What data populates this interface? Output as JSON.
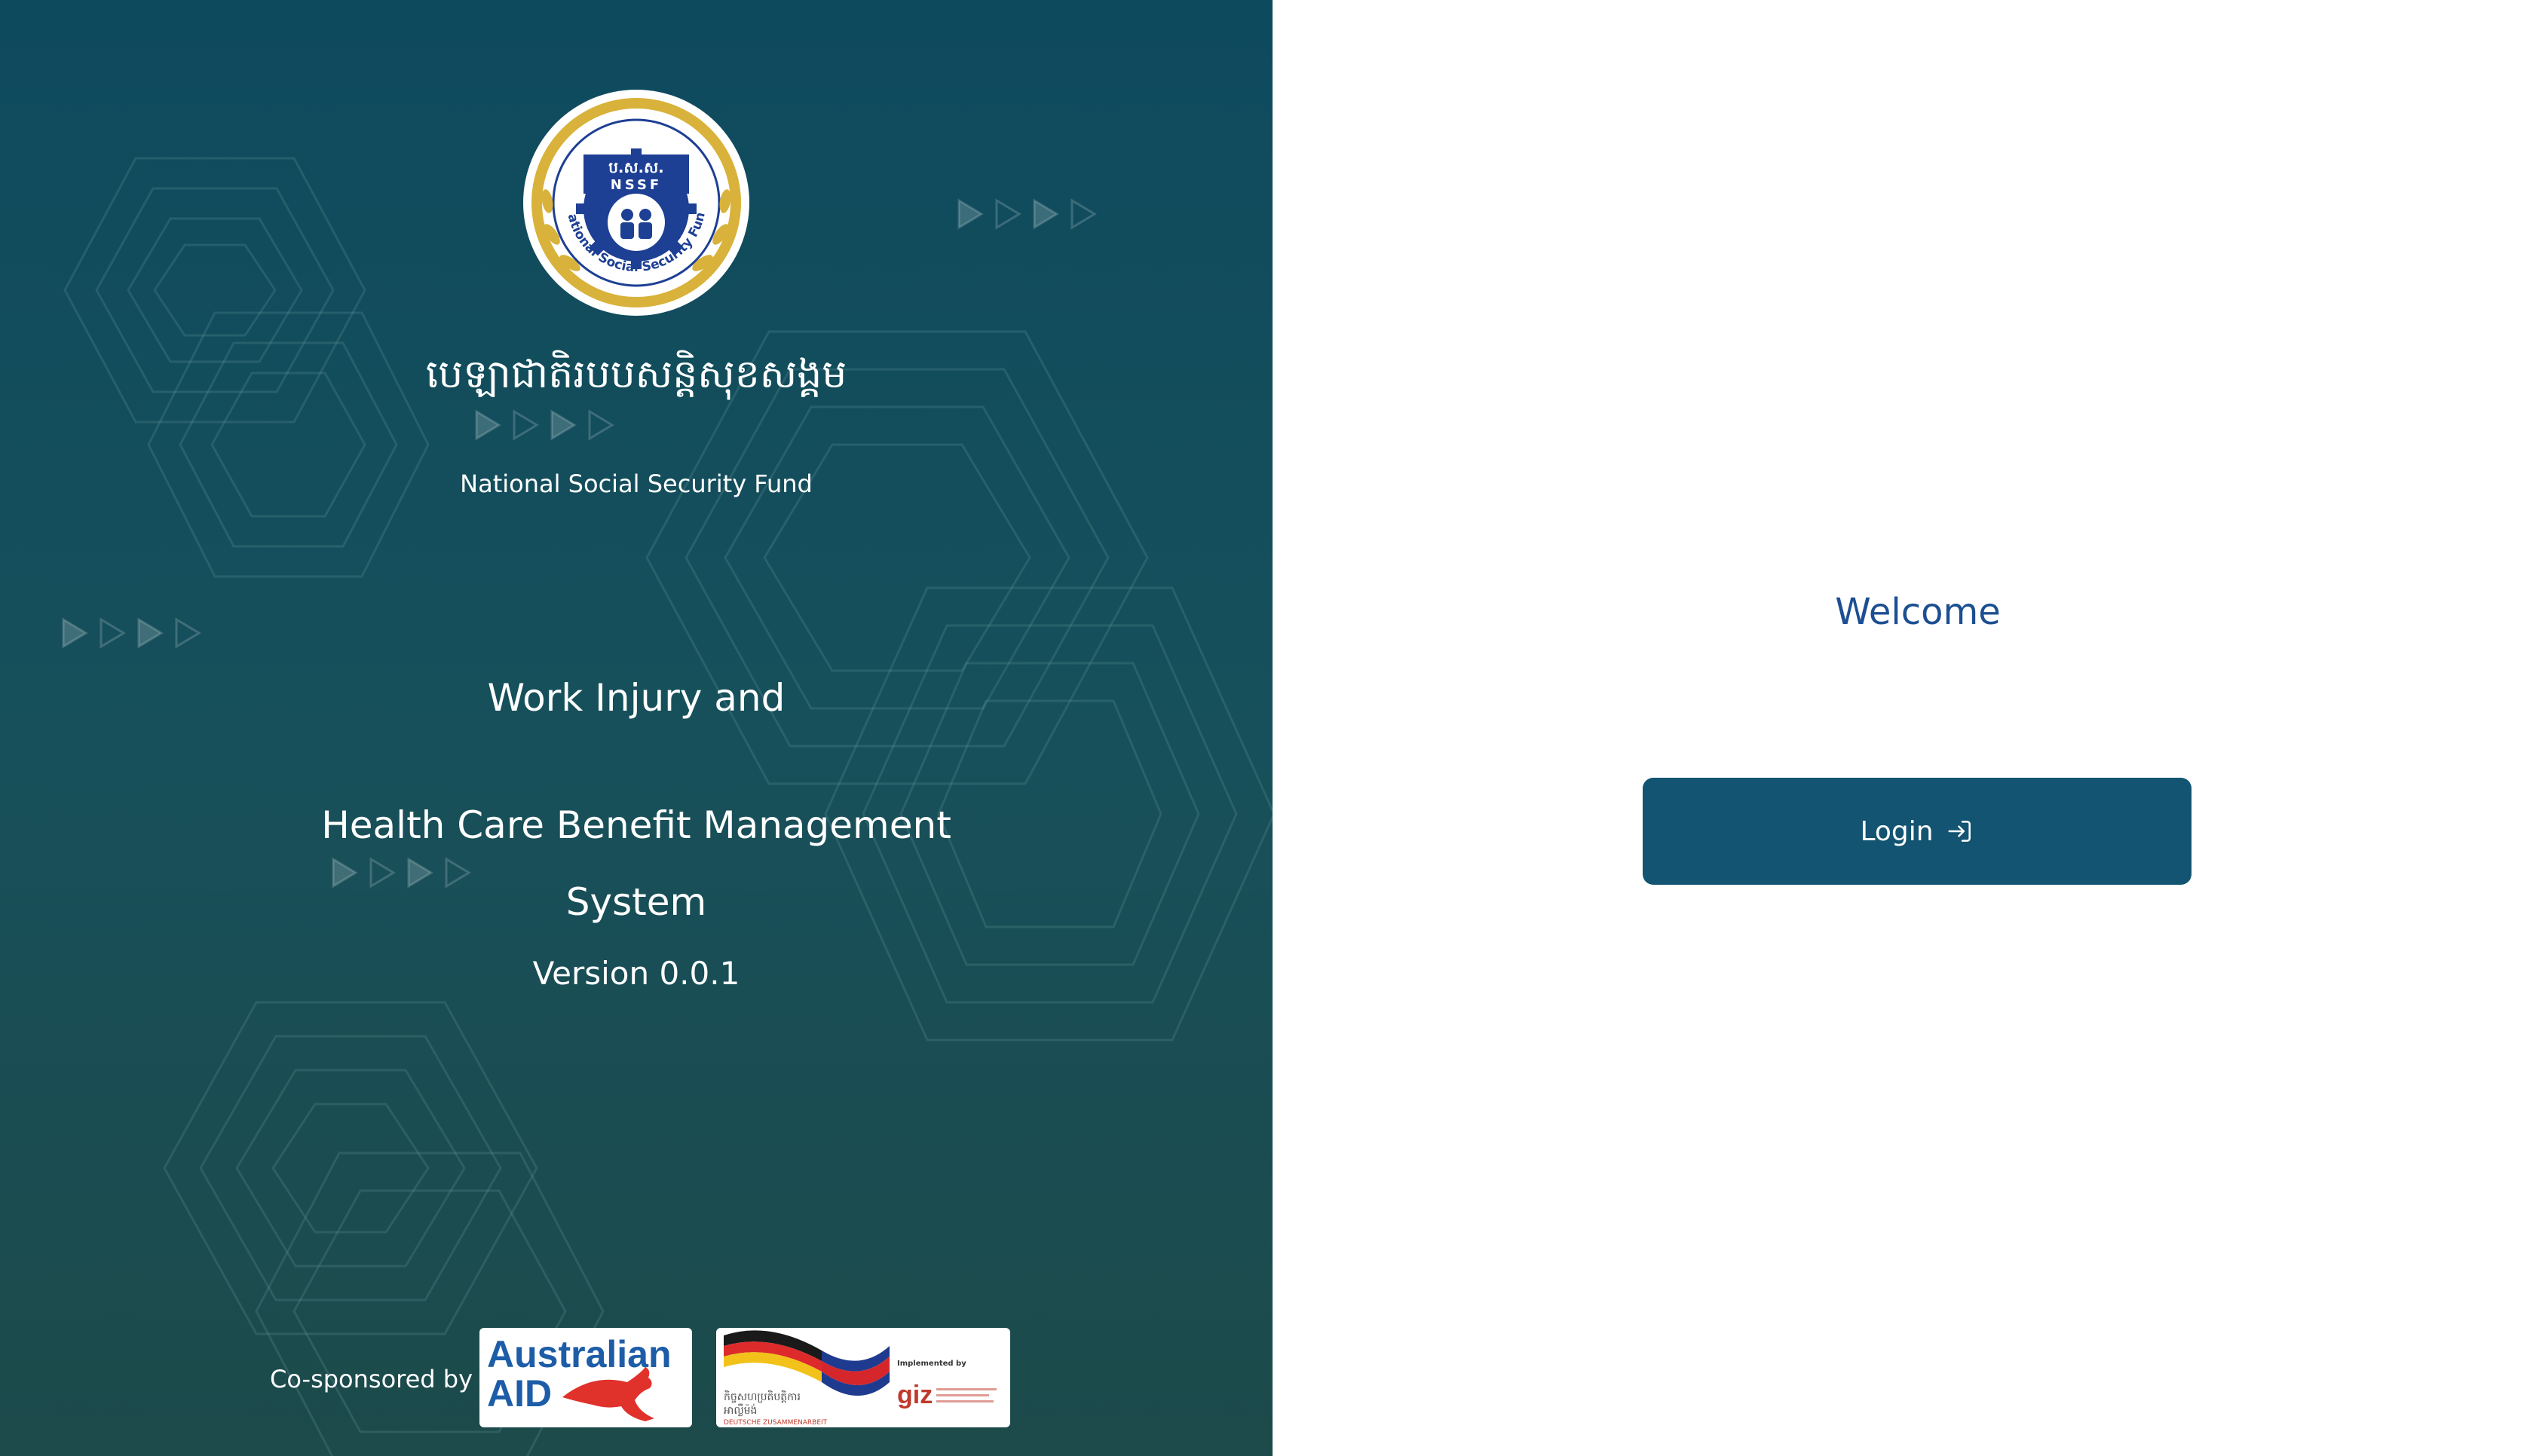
{
  "brand": {
    "logo": {
      "abbreviation": "ប.ស.ស.",
      "acronym": "NSSF",
      "ring_text": "National Social Security Fund"
    },
    "khmer_title": "បេឡាជាតិរបបសន្តិសុខសង្គម",
    "org_name": "National Social Security Fund",
    "app_title_line1": "Work Injury and",
    "app_title_line2": "Health Care Benefit Management System",
    "version": "Version 0.0.1",
    "cosponsor_label": "Co-sponsored by",
    "sponsors": {
      "australian_aid": {
        "line1": "Australian",
        "line2": "AID"
      },
      "giz": {
        "implemented_by": "Implemented by",
        "name": "giz",
        "footer": "DEUTSCHE ZUSAMMENARBEIT"
      }
    },
    "colors": {
      "gradient_top": "#0e4a5e",
      "gradient_bottom": "#1d4a4a"
    }
  },
  "login": {
    "welcome": "Welcome",
    "button_label": "Login",
    "button_icon": "login-arrow-icon",
    "colors": {
      "welcome_text": "#1c4f91",
      "button_bg": "#125471"
    }
  }
}
